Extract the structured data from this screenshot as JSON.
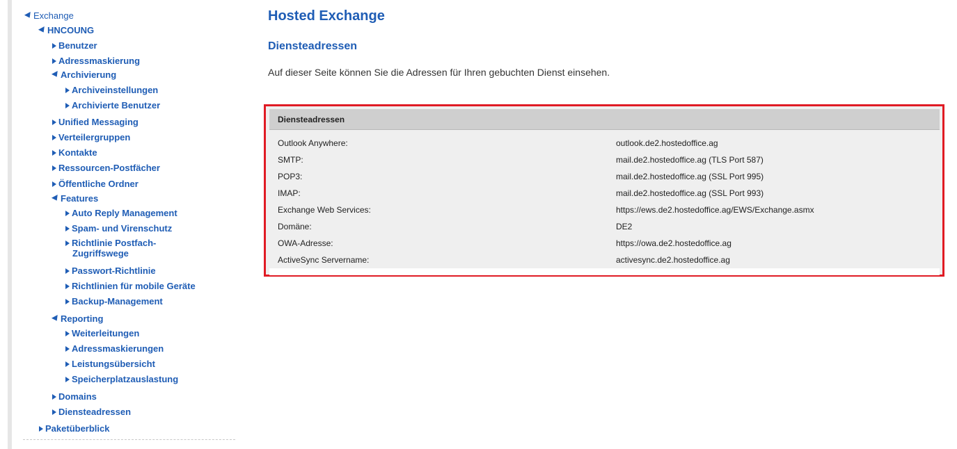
{
  "nav": {
    "items": [
      {
        "label": "Exchange",
        "expanded": true
      },
      {
        "label": "HNCOUNG",
        "expanded": true
      },
      {
        "label": "Benutzer",
        "expanded": false
      },
      {
        "label": "Adressmaskierung",
        "expanded": false
      },
      {
        "label": "Archivierung",
        "expanded": true
      },
      {
        "label": "Archiveinstellungen",
        "expanded": false
      },
      {
        "label": "Archivierte Benutzer",
        "expanded": false
      },
      {
        "label": "Unified Messaging",
        "expanded": false
      },
      {
        "label": "Verteilergruppen",
        "expanded": false
      },
      {
        "label": "Kontakte",
        "expanded": false
      },
      {
        "label": "Ressourcen-Postfächer",
        "expanded": false
      },
      {
        "label": "Öffentliche Ordner",
        "expanded": false
      },
      {
        "label": "Features",
        "expanded": true
      },
      {
        "label": "Auto Reply Management",
        "expanded": false
      },
      {
        "label": "Spam- und Virenschutz",
        "expanded": false
      },
      {
        "label": "Richtlinie Postfach-",
        "label2": "Zugriffswege",
        "expanded": false
      },
      {
        "label": "Passwort-Richtlinie",
        "expanded": false
      },
      {
        "label": "Richtlinien für mobile Geräte",
        "expanded": false
      },
      {
        "label": "Backup-Management",
        "expanded": false
      },
      {
        "label": "Reporting",
        "expanded": true
      },
      {
        "label": "Weiterleitungen",
        "expanded": false
      },
      {
        "label": "Adressmaskierungen",
        "expanded": false
      },
      {
        "label": "Leistungsübersicht",
        "expanded": false
      },
      {
        "label": "Speicherplatzauslastung",
        "expanded": false
      },
      {
        "label": "Domains",
        "expanded": false
      },
      {
        "label": "Diensteadressen",
        "expanded": false
      },
      {
        "label": "Paketüberblick",
        "expanded": false
      }
    ]
  },
  "main": {
    "title": "Hosted Exchange",
    "section_title": "Diensteadressen",
    "intro": "Auf dieser Seite können Sie die Adressen für Ihren gebuchten Dienst einsehen.",
    "panel": {
      "header": "Diensteadressen",
      "rows": [
        {
          "key": "Outlook Anywhere:",
          "value": "outlook.de2.hostedoffice.ag"
        },
        {
          "key": "SMTP:",
          "value": "mail.de2.hostedoffice.ag (TLS Port 587)"
        },
        {
          "key": "POP3:",
          "value": "mail.de2.hostedoffice.ag (SSL Port 995)"
        },
        {
          "key": "IMAP:",
          "value": "mail.de2.hostedoffice.ag (SSL Port 993)"
        },
        {
          "key": "Exchange Web Services:",
          "value": "https://ews.de2.hostedoffice.ag/EWS/Exchange.asmx"
        },
        {
          "key": "Domäne:",
          "value": "DE2"
        },
        {
          "key": "OWA-Adresse:",
          "value": "https://owa.de2.hostedoffice.ag"
        },
        {
          "key": "ActiveSync Servername:",
          "value": "activesync.de2.hostedoffice.ag"
        }
      ]
    }
  },
  "colors": {
    "link": "#1f5db5",
    "highlight_border": "#e01b24",
    "panel_header_bg": "#cfcfcf",
    "panel_bg": "#efefef"
  }
}
